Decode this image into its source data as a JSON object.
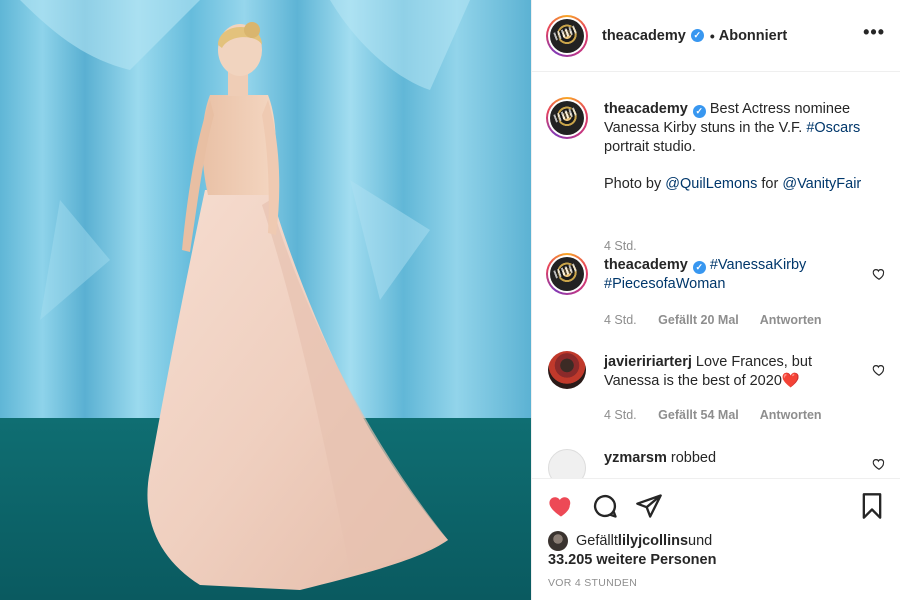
{
  "header": {
    "username": "theacademy",
    "verified": "verified-badge",
    "separator": "•",
    "follow_status": "Abonniert",
    "more": "•••"
  },
  "caption": {
    "username": "theacademy",
    "text_1": " Best Actress nominee Vanessa Kirby stuns in the V.F. ",
    "hashtag_oscars": "#Oscars",
    "text_2": " portrait studio.",
    "photo_by": "Photo by ",
    "mention_1": "@QuilLemons",
    "for": " for ",
    "mention_2": "@VanityFair",
    "time": "4 Std."
  },
  "comments": [
    {
      "username": "theacademy",
      "tag_1": "#VanessaKirby",
      "tag_2": "#PiecesofaWoman",
      "time": "4 Std.",
      "likes": "Gefällt 20 Mal",
      "reply": "Antworten"
    },
    {
      "username": "javieririarterj",
      "text": " Love Frances, but Vanessa is the best of 2020",
      "emoji": "❤️",
      "time": "4 Std.",
      "likes": "Gefällt 54 Mal",
      "reply": "Antworten"
    },
    {
      "username": "yzmarsm",
      "text": " robbed"
    }
  ],
  "likes": {
    "prefix": "Gefällt ",
    "user": "lilyjcollins",
    "and": " und",
    "count": "33.205 weitere Personen"
  },
  "timestamp": "Vor 4 Stunden",
  "colors": {
    "accent_link": "#00376b",
    "like_red": "#ed4956",
    "verified_blue": "#3897f0",
    "muted": "#8e8e8e"
  }
}
